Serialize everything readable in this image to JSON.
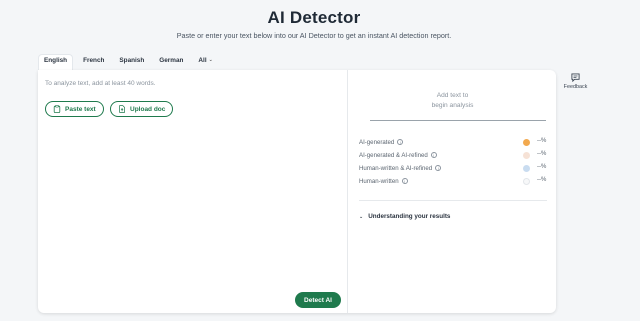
{
  "header": {
    "title": "AI Detector",
    "subtitle": "Paste or enter your text below into our AI Detector to get an instant AI detection report."
  },
  "tabs": [
    {
      "label": "English",
      "active": true
    },
    {
      "label": "French"
    },
    {
      "label": "Spanish"
    },
    {
      "label": "German"
    },
    {
      "label": "All"
    }
  ],
  "editor": {
    "placeholder": "To analyze text, add at least 40 words.",
    "paste_label": "Paste text",
    "upload_label": "Upload doc",
    "detect_label": "Detect AI"
  },
  "results": {
    "empty_line1": "Add text to",
    "empty_line2": "begin analysis",
    "rows": [
      {
        "label": "AI-generated",
        "value": "--%",
        "color": "#f2a94e"
      },
      {
        "label": "AI-generated & AI-refined",
        "value": "--%",
        "color": "#f6e2d6"
      },
      {
        "label": "Human-written & AI-refined",
        "value": "--%",
        "color": "#c9dcf0"
      },
      {
        "label": "Human-written",
        "value": "--%",
        "color": "#f7f8f9"
      }
    ],
    "understanding_label": "Understanding your results"
  },
  "feedback": {
    "label": "Feedback"
  },
  "colors": {
    "accent": "#1f7a4d"
  }
}
